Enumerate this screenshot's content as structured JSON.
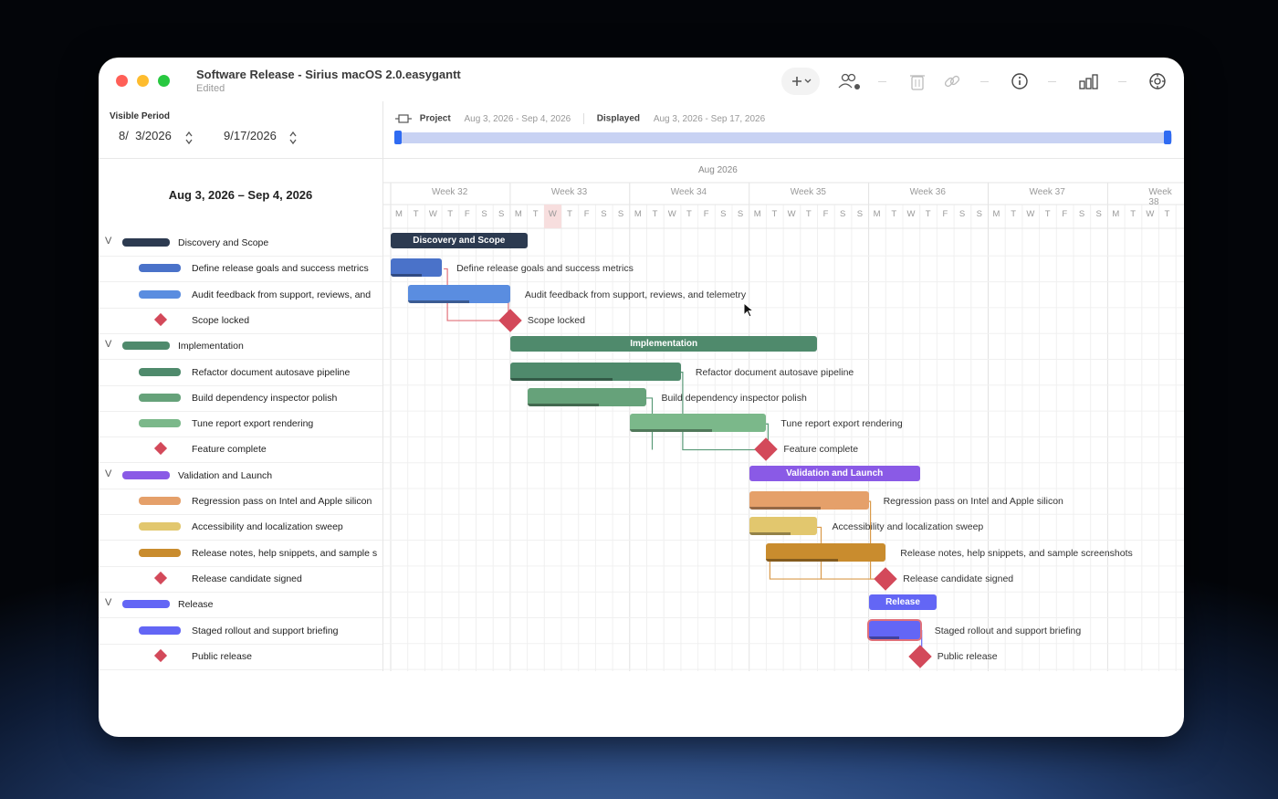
{
  "window": {
    "title": "Software Release - Sirius macOS 2.0.easygantt",
    "status": "Edited"
  },
  "toolbar": {
    "add_icon": "plus-chevron-icon",
    "icons": [
      "add-people-icon",
      "trash-icon",
      "link-icon",
      "info-icon",
      "chart-icon",
      "settings-icon"
    ]
  },
  "visible_period": {
    "label": "Visible Period",
    "start": "8/  3/2026",
    "end": "9/17/2026"
  },
  "project_info": {
    "project_label": "Project",
    "project_range": "Aug 3, 2026 - Sep 4, 2026",
    "displayed_label": "Displayed",
    "displayed_range": "Aug 3, 2026 - Sep 17, 2026"
  },
  "range_title": "Aug 3, 2026 – Sep 4, 2026",
  "timeline": {
    "month": "Aug 2026",
    "weeks": [
      "Week 32",
      "Week 33",
      "Week 34",
      "Week 35",
      "Week 36",
      "Week 37",
      "Week 38"
    ],
    "day_letters": [
      "M",
      "T",
      "W",
      "T",
      "F",
      "S",
      "S"
    ]
  },
  "colors": {
    "discovery": "#2c3a50",
    "implementation": "#4f8a6c",
    "validation": "#8a5ae6",
    "release": "#6366f5",
    "milestone": "#d3495a"
  },
  "tasks": [
    {
      "type": "group",
      "label": "Discovery and Scope",
      "color": "#2c3a50",
      "start": 0,
      "duration": 8
    },
    {
      "type": "task",
      "label": "Define release goals and success metrics",
      "color": "#4a72c9",
      "start": 0,
      "duration": 3
    },
    {
      "type": "task",
      "label": "Audit feedback from support, reviews, and telemetry",
      "sidebar_label": "Audit feedback from support, reviews, and",
      "color": "#5a8de0",
      "start": 1,
      "duration": 6
    },
    {
      "type": "milestone",
      "label": "Scope locked",
      "start": 7
    },
    {
      "type": "group",
      "label": "Implementation",
      "color": "#4f8a6c",
      "start": 7,
      "duration": 18
    },
    {
      "type": "task",
      "label": "Refactor document autosave pipeline",
      "color": "#4f8a6c",
      "start": 7,
      "duration": 10
    },
    {
      "type": "task",
      "label": "Build dependency inspector polish",
      "color": "#66a27a",
      "start": 8,
      "duration": 7
    },
    {
      "type": "task",
      "label": "Tune report export rendering",
      "color": "#7bb88a",
      "start": 14,
      "duration": 8
    },
    {
      "type": "milestone",
      "label": "Feature complete",
      "start": 22
    },
    {
      "type": "group",
      "label": "Validation and Launch",
      "color": "#8a5ae6",
      "start": 21,
      "duration": 10
    },
    {
      "type": "task",
      "label": "Regression pass on Intel and Apple silicon",
      "color": "#e5a06a",
      "start": 21,
      "duration": 7
    },
    {
      "type": "task",
      "label": "Accessibility and localization sweep",
      "color": "#e2c76e",
      "start": 21,
      "duration": 4
    },
    {
      "type": "task",
      "label": "Release notes, help snippets, and sample screenshots",
      "sidebar_label": "Release notes, help snippets, and sample s",
      "color": "#c98c2e",
      "start": 22,
      "duration": 7
    },
    {
      "type": "milestone",
      "label": "Release candidate signed",
      "start": 29
    },
    {
      "type": "group",
      "label": "Release",
      "color": "#6366f5",
      "start": 28,
      "duration": 4
    },
    {
      "type": "task",
      "label": "Staged rollout and support briefing",
      "color": "#6366f5",
      "start": 28,
      "duration": 3
    },
    {
      "type": "milestone",
      "label": "Public release",
      "start": 31
    }
  ]
}
